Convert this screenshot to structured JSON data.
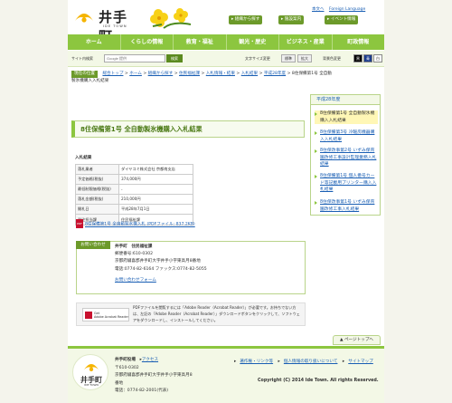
{
  "header": {
    "logo_text": "井手町",
    "logo_sub": "IDE TOWN",
    "top_links": [
      "本文へ",
      "Foreign Language"
    ],
    "buttons": [
      "組織から探す",
      "施設案内",
      "イベント情報"
    ]
  },
  "nav": [
    "ホーム",
    "くらしの情報",
    "教育・福祉",
    "観光・歴史",
    "ビジネス・産業",
    "町政情報"
  ],
  "search": {
    "label": "サイト内検索",
    "placeholder": "Google 提供",
    "button": "検索",
    "font_label": "文字サイズ変更",
    "font_buttons": [
      "標準",
      "拡大"
    ],
    "bg_label": "背景色変更",
    "bg_buttons": [
      "黒",
      "青",
      "白"
    ]
  },
  "breadcrumb": {
    "tag": "現在の位置",
    "items": [
      "総合トップ",
      "ホーム",
      "組織から探す",
      "住民福祉課",
      "入札情報・結果",
      "入札結果",
      "平成28年度",
      "8住保備第1号 全自動製氷機購入入札結果"
    ]
  },
  "page_title": "8住保備第1号 全自動製氷機購入入札結果",
  "table": {
    "heading": "入札結果",
    "rows": [
      {
        "k": "落札業者",
        "v": "ダイヤコミ株式会社 京都南支店"
      },
      {
        "k": "予定価格(税抜)",
        "v": "374,000円"
      },
      {
        "k": "最低制限価格(税抜)",
        "v": "-"
      },
      {
        "k": "落札金額(税抜)",
        "v": "210,000円"
      },
      {
        "k": "開札日",
        "v": "平成28年7月1日"
      },
      {
        "k": "発注担当課",
        "v": "住民福祉課"
      }
    ]
  },
  "pdf": {
    "icon": "PDF",
    "link": "8住保備第1号 全自動製氷機入札 (PDFファイル: 837.2KB)"
  },
  "contact": {
    "tag": "お問い合わせ",
    "name": "井手町　住民福祉課",
    "postal": "郵便番号:610-0302",
    "address": "京都府綴喜郡井手町大字井手小字東高月8番地",
    "phone": "電話:0774-82-6164 ファックス:0774-82-5055",
    "form_link": "お問い合わせフォーム"
  },
  "adobe": {
    "badge_line1": "Get",
    "badge_line2": "Adobe Acrobat Reader",
    "text": "PDFファイルを閲覧するには「Adobe Reader（Acrobat Reader）」が必要です。お持ちでない方は、左記の「Adobe Reader（Acrobat Reader）」ダウンロードボタンをクリックして、ソフトウェアをダウンロードし、インストールしてください。"
  },
  "sidebar": {
    "header": "平成28年度",
    "items": [
      "8住保備第1号 全自動製氷機購入入札結果",
      "8住保備第3号 冷暖房機器購入入札結果",
      "8住保改事第2号 いずみ保育園改修工事設計監理業務入札結果",
      "8住保備第1号 個人番号カード等記載用プリンター購入入札結果",
      "8住保改事第1号 いずみ保育園改修工事入札結果"
    ]
  },
  "page_top": "ページトップへ",
  "footer": {
    "logo_text": "井手町",
    "logo_sub": "IDE TOWN",
    "office": "井手町役場",
    "access": "アクセス",
    "postal": "〒610-0302",
    "address1": "京都府綴喜郡井手町大字井手小字東高月8",
    "address2": "番地",
    "phone": "電話：0774-82-2001(代表)",
    "links": [
      "著作権・リンク等",
      "個人情報の取り扱いについて",
      "サイトマップ"
    ],
    "copyright": "Copyright (C) 2014 Ide Town. All rights Reserved."
  },
  "colors": {
    "accent": "#8cc63f",
    "accent_dark": "#6c9a2a",
    "link": "#1a5fb4"
  }
}
